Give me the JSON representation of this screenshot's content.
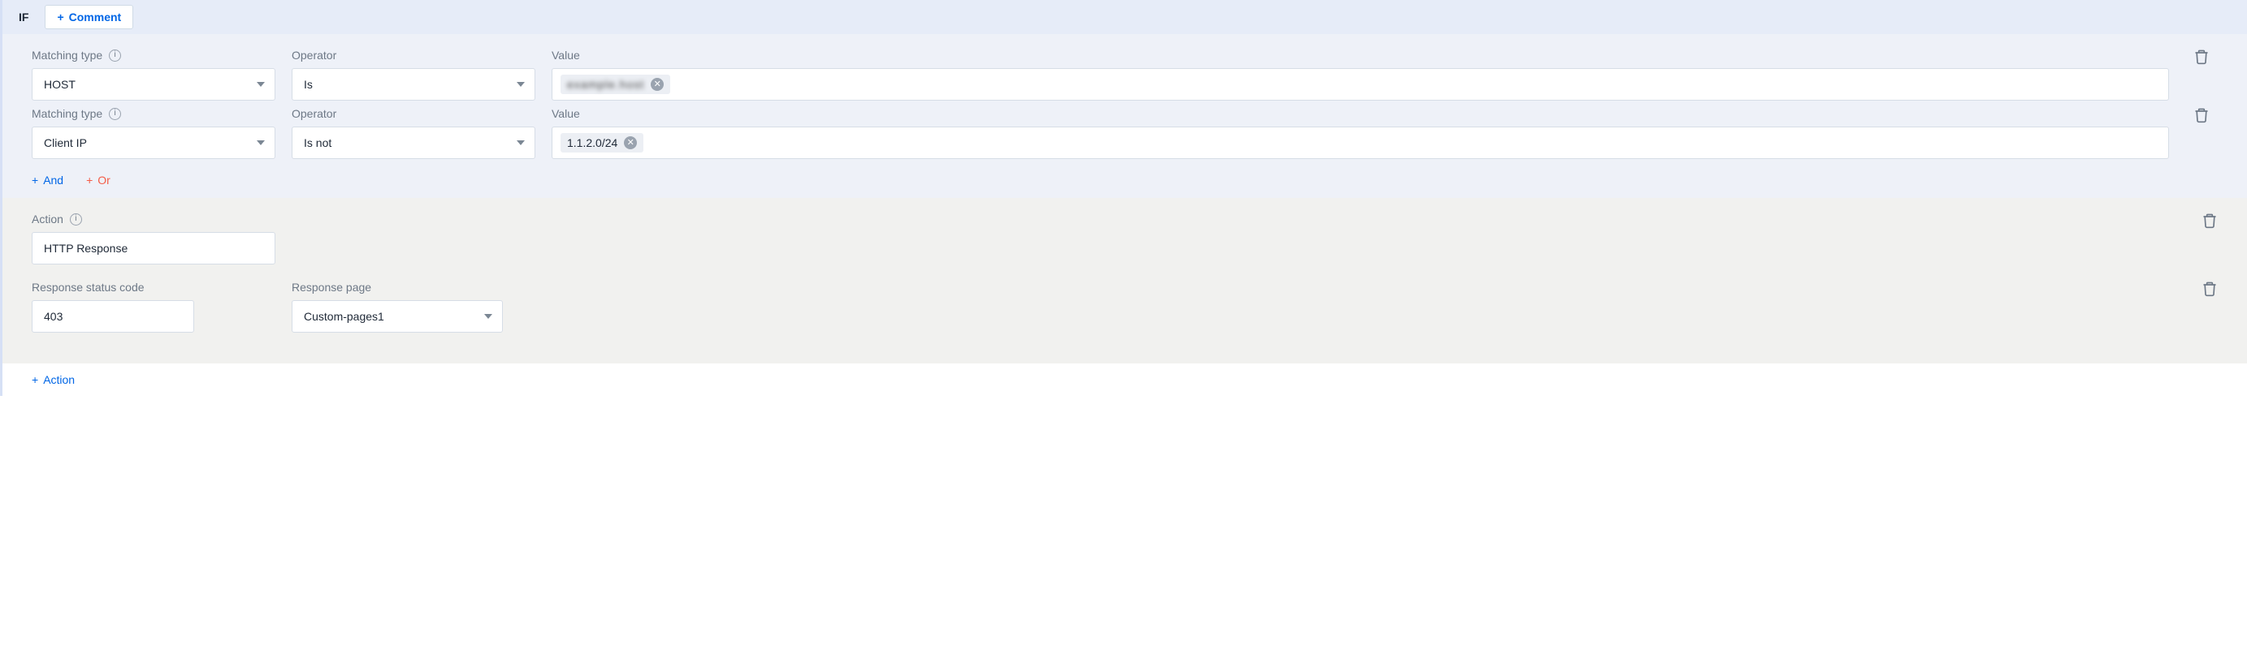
{
  "header": {
    "if_label": "IF",
    "comment_label": "Comment"
  },
  "labels": {
    "matching_type": "Matching type",
    "operator": "Operator",
    "value": "Value",
    "action": "Action",
    "response_status_code": "Response status code",
    "response_page": "Response page"
  },
  "conditions": [
    {
      "matching_type": "HOST",
      "operator": "Is",
      "value_chips": [
        {
          "text": "example.host",
          "blurred": true
        }
      ]
    },
    {
      "matching_type": "Client IP",
      "operator": "Is not",
      "value_chips": [
        {
          "text": "1.1.2.0/24",
          "blurred": false
        }
      ]
    }
  ],
  "and_or": {
    "and": "And",
    "or": "Or"
  },
  "action_block": {
    "action_value": "HTTP Response",
    "status_code": "403",
    "response_page": "Custom-pages1"
  },
  "footer": {
    "add_action": "Action"
  }
}
